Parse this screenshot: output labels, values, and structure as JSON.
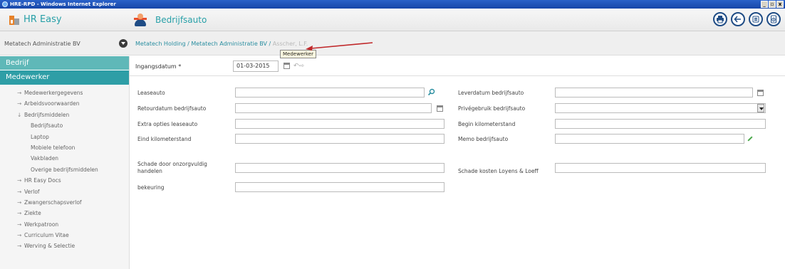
{
  "window": {
    "title": "HRE-RPD - Windows Internet Explorer",
    "buttons": [
      "_",
      "▫",
      "x"
    ]
  },
  "header": {
    "app_name": "HR Easy",
    "page_title": "Bedrijfsauto"
  },
  "subbar": {
    "company": "Metatech Administratie BV",
    "breadcrumb": [
      "Metatech Holding",
      "Metatech Administratie BV",
      "Asscher, L.F."
    ],
    "tooltip": "Medewerker"
  },
  "sidebar": {
    "section_company": "Bedrijf",
    "section_employee": "Medewerker",
    "items": [
      {
        "label": "Medewerkergegevens",
        "arrow": "→",
        "sub": false
      },
      {
        "label": "Arbeidsvoorwaarden",
        "arrow": "→",
        "sub": false
      },
      {
        "label": "Bedrijfsmiddelen",
        "arrow": "↓",
        "sub": false
      },
      {
        "label": "Bedrijfsauto",
        "arrow": "",
        "sub": true
      },
      {
        "label": "Laptop",
        "arrow": "",
        "sub": true
      },
      {
        "label": "Mobiele telefoon",
        "arrow": "",
        "sub": true
      },
      {
        "label": "Vakbladen",
        "arrow": "",
        "sub": true
      },
      {
        "label": "Overige bedrijfsmiddelen",
        "arrow": "",
        "sub": true
      },
      {
        "label": "HR Easy Docs",
        "arrow": "→",
        "sub": false
      },
      {
        "label": "Verlof",
        "arrow": "→",
        "sub": false
      },
      {
        "label": "Zwangerschapsverlof",
        "arrow": "→",
        "sub": false
      },
      {
        "label": "Ziekte",
        "arrow": "→",
        "sub": false
      },
      {
        "label": "Werkpatroon",
        "arrow": "→",
        "sub": false
      },
      {
        "label": "Curriculum Vitae",
        "arrow": "→",
        "sub": false
      },
      {
        "label": "Werving & Selectie",
        "arrow": "→",
        "sub": false
      }
    ]
  },
  "form": {
    "ingangsdatum_label": "Ingangsdatum *",
    "ingangsdatum_value": "01-03-2015",
    "left": [
      {
        "label": "Leaseauto",
        "value": ""
      },
      {
        "label": "Retourdatum bedrijfsauto",
        "value": ""
      },
      {
        "label": "Extra opties leaseauto",
        "value": ""
      },
      {
        "label": "Eind kilometerstand",
        "value": ""
      },
      {
        "label": "Schade door onzorgvuldig handelen",
        "value": ""
      },
      {
        "label": "bekeuring",
        "value": ""
      }
    ],
    "right": [
      {
        "label": "Leverdatum bedrijfsauto",
        "value": ""
      },
      {
        "label": "Privégebruik bedrijfsauto",
        "value": ""
      },
      {
        "label": "Begin kilometerstand",
        "value": ""
      },
      {
        "label": "Memo bedrijfsauto",
        "value": ""
      },
      {
        "label": "Schade kosten Loyens & Loeff",
        "value": ""
      }
    ]
  },
  "colors": {
    "accent": "#2e9ea6",
    "brand_text": "#28a0a8",
    "tool_blue": "#1f4c85"
  },
  "icons": [
    "ie-icon",
    "hr-easy-logo",
    "car-person-icon",
    "print-icon",
    "back-icon",
    "list-icon",
    "clock-icon",
    "chevron-down-icon",
    "calendar-icon",
    "undo-icon",
    "search-icon",
    "dropdown-icon",
    "pencil-icon"
  ]
}
